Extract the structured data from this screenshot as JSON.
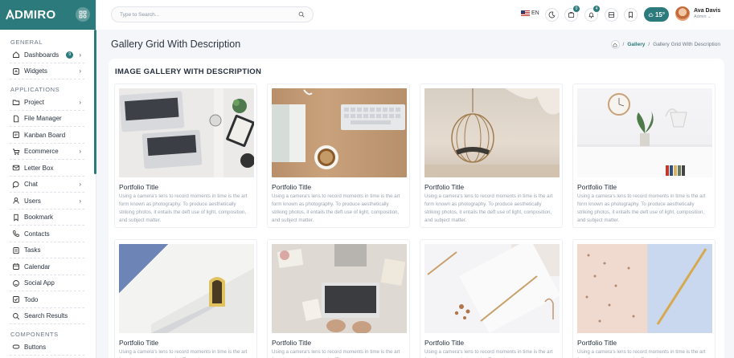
{
  "brand": {
    "name": "DMIRO"
  },
  "sidebar": {
    "sections": [
      {
        "title": "GENERAL"
      },
      {
        "title": "APPLICATIONS"
      },
      {
        "title": "COMPONENTS"
      }
    ],
    "items": [
      {
        "label": "Dashboards",
        "icon": "home-icon",
        "badge": "9",
        "chevron": true
      },
      {
        "label": "Widgets",
        "icon": "widgets-icon",
        "chevron": true
      },
      {
        "label": "Project",
        "icon": "folder-icon",
        "chevron": true
      },
      {
        "label": "File Manager",
        "icon": "file-icon",
        "chevron": false
      },
      {
        "label": "Kanban Board",
        "icon": "kanban-icon",
        "chevron": false
      },
      {
        "label": "Ecommerce",
        "icon": "cart-icon",
        "chevron": true
      },
      {
        "label": "Letter Box",
        "icon": "mail-icon",
        "chevron": false
      },
      {
        "label": "Chat",
        "icon": "chat-icon",
        "chevron": true
      },
      {
        "label": "Users",
        "icon": "users-icon",
        "chevron": true
      },
      {
        "label": "Bookmark",
        "icon": "bookmark-icon",
        "chevron": false
      },
      {
        "label": "Contacts",
        "icon": "phone-icon",
        "chevron": false
      },
      {
        "label": "Tasks",
        "icon": "tasks-icon",
        "chevron": false
      },
      {
        "label": "Calendar",
        "icon": "calendar-icon",
        "chevron": false
      },
      {
        "label": "Social App",
        "icon": "social-icon",
        "chevron": false
      },
      {
        "label": "Todo",
        "icon": "todo-icon",
        "chevron": false
      },
      {
        "label": "Search Results",
        "icon": "search-icon",
        "chevron": false
      },
      {
        "label": "Buttons",
        "icon": "button-icon",
        "chevron": false
      }
    ]
  },
  "header": {
    "search_placeholder": "Type to Search...",
    "language": "EN",
    "cart_count": "0",
    "notification_count": "4",
    "weather": "15°",
    "user_name": "Ava Davis",
    "user_role": "Admin"
  },
  "page": {
    "title": "Gallery Grid With Description",
    "breadcrumb_parent": "Gallery",
    "breadcrumb_current": "Gallery Grid With Description"
  },
  "card": {
    "title": "IMAGE GALLERY WITH DESCRIPTION",
    "tiles": [
      {
        "title": "Portfolio Title",
        "desc": "Using a camera's lens to record moments in time is the art form known as photography. To produce aesthetically striking photos, it entails the deft use of light, composition, and subject matter."
      },
      {
        "title": "Portfolio Title",
        "desc": "Using a camera's lens to record moments in time is the art form known as photography. To produce aesthetically striking photos, it entails the deft use of light, composition, and subject matter."
      },
      {
        "title": "Portfolio Title",
        "desc": "Using a camera's lens to record moments in time is the art form known as photography. To produce aesthetically striking photos, it entails the deft use of light, composition, and subject matter."
      },
      {
        "title": "Portfolio Title",
        "desc": "Using a camera's lens to record moments in time is the art form known as photography. To produce aesthetically striking photos, it entails the deft use of light, composition, and subject matter."
      },
      {
        "title": "Portfolio Title",
        "desc": "Using a camera's lens to record moments in time is the art form known as photography. To produce"
      },
      {
        "title": "Portfolio Title",
        "desc": "Using a camera's lens to record moments in time is the art form known as photography. To produce"
      },
      {
        "title": "Portfolio Title",
        "desc": "Using a camera's lens to record moments in time is the art form known as photography. To produce"
      },
      {
        "title": "Portfolio Title",
        "desc": "Using a camera's lens to record moments in time is the art form known as photography. To produce"
      }
    ]
  }
}
